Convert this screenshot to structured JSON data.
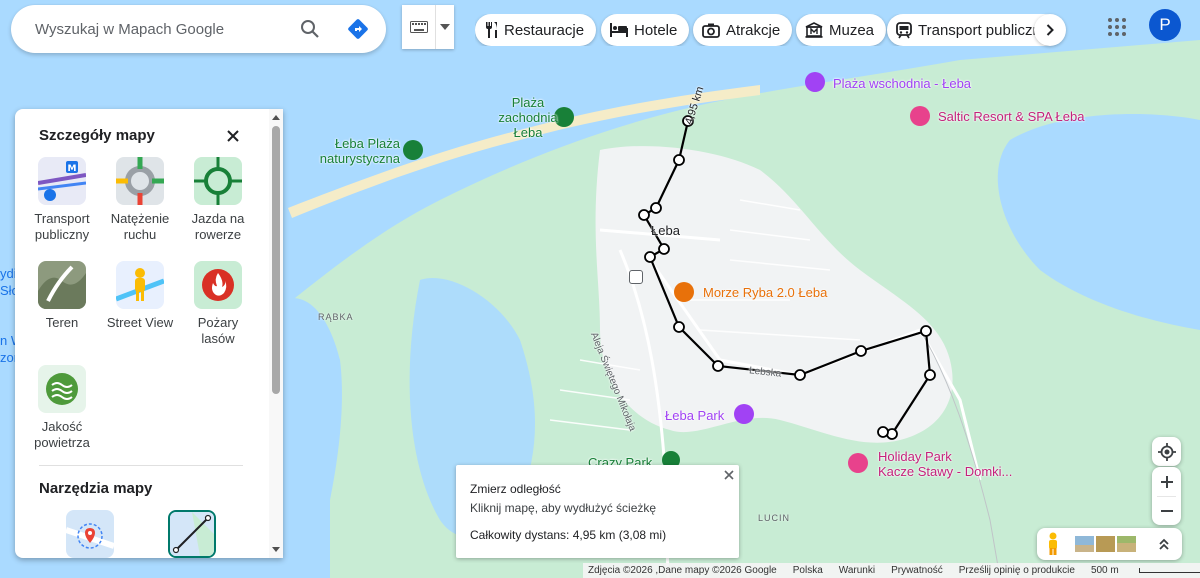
{
  "search": {
    "placeholder": "Wyszukaj w Mapach Google"
  },
  "chips": [
    {
      "label": "Restauracje",
      "icon": "restaurant-icon"
    },
    {
      "label": "Hotele",
      "icon": "hotel-icon"
    },
    {
      "label": "Atrakcje",
      "icon": "camera-icon"
    },
    {
      "label": "Muzea",
      "icon": "museum-icon"
    },
    {
      "label": "Transport publiczny",
      "icon": "transit-icon"
    }
  ],
  "user": {
    "initial": "P",
    "avatar_color": "#0b57d0"
  },
  "panel": {
    "title": "Szczegóły mapy",
    "layers": [
      {
        "label": "Transport publiczny"
      },
      {
        "label": "Natężenie ruchu"
      },
      {
        "label": "Jazda na rowerze"
      },
      {
        "label": "Teren"
      },
      {
        "label": "Street View"
      },
      {
        "label": "Pożary lasów"
      },
      {
        "label": "Jakość powietrza"
      }
    ],
    "tools_title": "Narzędzia mapy"
  },
  "map": {
    "labels": {
      "plaza_wschodnia": "Plaża wschodnia - Łeba",
      "saltic": "Saltic Resort & SPA Łeba",
      "plaza_zachodnia": "Plaża\nzachodnia\nŁeba",
      "leba_plaza": "Łeba Plaża\nnaturystyczna",
      "leba": "Łeba",
      "morze_ryba": "Morze Ryba 2.0 Łeba",
      "rabka": "RĄBKA",
      "aleja": "Aleja Świętego Mikołaja",
      "lebska": "Łebska",
      "leba_park": "Łeba Park",
      "crazy_park": "Crazy Park",
      "holiday_park": "Holiday Park\nKacze Stawy - Domki...",
      "lucin": "LUCIN",
      "dist_label": "4,95 km",
      "edge_left1": "ydi",
      "edge_left2": "Sło",
      "edge_left3": "n W",
      "edge_left4": "zor"
    },
    "colors": {
      "water": "#aadaff",
      "land": "#f1f3f4",
      "green": "#c8ecd4",
      "route": "#000000"
    }
  },
  "measure": {
    "title": "Zmierz odległość",
    "hint": "Kliknij mapę, aby wydłużyć ścieżkę",
    "distance": "Całkowity dystans: 4,95 km (3,08 mi)"
  },
  "footer": {
    "copyright": "Zdjęcia ©2026 ,Dane mapy ©2026 Google",
    "country": "Polska",
    "terms": "Warunki",
    "privacy": "Prywatność",
    "feedback": "Prześlij opinię o produkcie",
    "scale": "500 m"
  }
}
